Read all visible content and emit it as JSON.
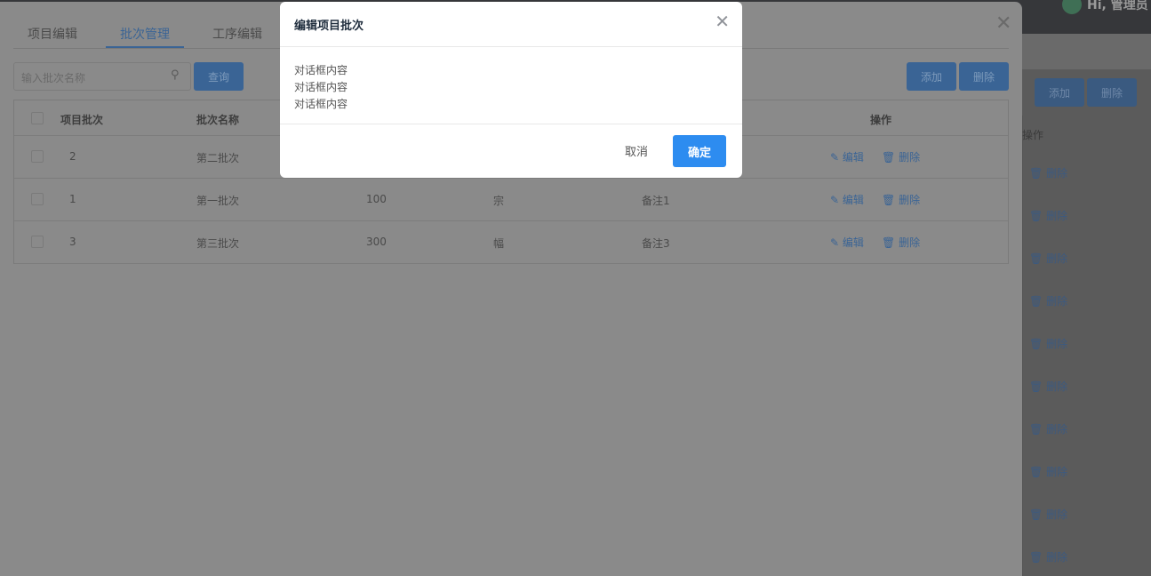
{
  "background": {
    "user_greeting": "Hi, 管理员",
    "add_label": "添加",
    "delete_label": "删除",
    "ops_header": "操作",
    "row_delete": "删除"
  },
  "drawer": {
    "tabs": [
      {
        "label": "项目编辑"
      },
      {
        "label": "批次管理"
      },
      {
        "label": "工序编辑"
      }
    ],
    "active_tab": "批次管理",
    "search_placeholder": "输入批次名称",
    "query_label": "查询",
    "add_label": "添加",
    "delete_label": "删除",
    "table": {
      "headers": [
        "项目批次",
        "批次名称",
        "",
        "",
        "",
        "操作"
      ],
      "rows": [
        [
          "2",
          "第二批次",
          "",
          "",
          "",
          ""
        ],
        [
          "1",
          "第一批次",
          "100",
          "宗",
          "备注1"
        ],
        [
          "3",
          "第三批次",
          "300",
          "幅",
          "备注3"
        ]
      ],
      "edit_label": "编辑",
      "delete_label": "删除"
    }
  },
  "dialog": {
    "title": "编辑项目批次",
    "body": [
      "对话框内容",
      "对话框内容",
      "对话框内容"
    ],
    "cancel_label": "取消",
    "ok_label": "确定",
    "accent": "#2d8cf0"
  }
}
